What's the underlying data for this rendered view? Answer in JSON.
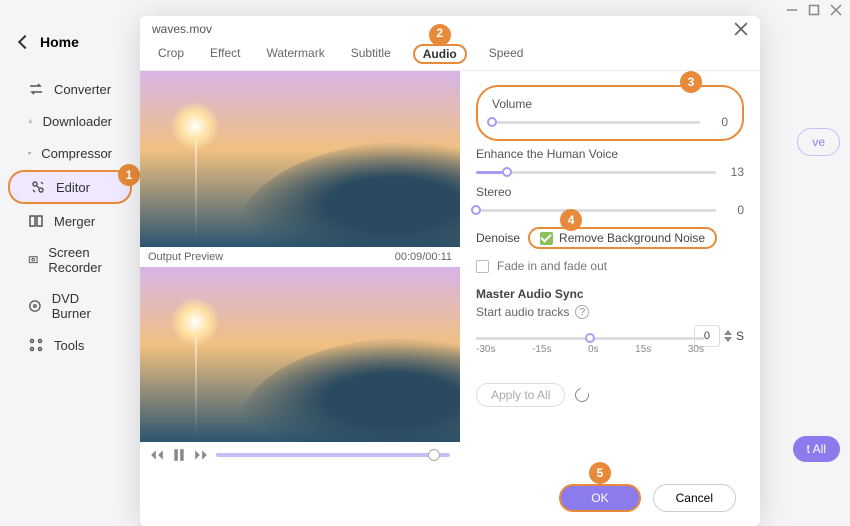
{
  "window": {
    "minimize": "min",
    "maximize": "max",
    "close": "close"
  },
  "home": {
    "label": "Home"
  },
  "sidebar": {
    "items": [
      {
        "label": "Converter"
      },
      {
        "label": "Downloader"
      },
      {
        "label": "Compressor"
      },
      {
        "label": "Editor"
      },
      {
        "label": "Merger"
      },
      {
        "label": "Screen Recorder"
      },
      {
        "label": "DVD Burner"
      },
      {
        "label": "Tools"
      }
    ],
    "activeIndex": 3,
    "step1": "1"
  },
  "modal": {
    "title": "waves.mov",
    "tabs": [
      {
        "label": "Crop"
      },
      {
        "label": "Effect"
      },
      {
        "label": "Watermark"
      },
      {
        "label": "Subtitle"
      },
      {
        "label": "Audio"
      },
      {
        "label": "Speed"
      }
    ],
    "activeTabIndex": 4,
    "step2": "2"
  },
  "preview": {
    "label": "Output Preview",
    "time": "00:09/00:11"
  },
  "audio": {
    "volume_label": "Volume",
    "volume_value": "0",
    "step3": "3",
    "enhance_label": "Enhance the Human Voice",
    "enhance_value": "13",
    "stereo_label": "Stereo",
    "stereo_value": "0",
    "denoise_label": "Denoise",
    "remove_noise_label": "Remove Background Noise",
    "step4": "4",
    "fade_label": "Fade in and fade out",
    "master_title": "Master Audio Sync",
    "start_label": "Start audio tracks",
    "sync_value": "0",
    "sync_unit": "S",
    "ticks": [
      "-30s",
      "-15s",
      "0s",
      "15s",
      "30s"
    ],
    "apply_label": "Apply to All"
  },
  "footer": {
    "ok": "OK",
    "cancel": "Cancel",
    "step5": "5"
  },
  "behind": {
    "btn1": "ve",
    "btn2": "t All"
  }
}
